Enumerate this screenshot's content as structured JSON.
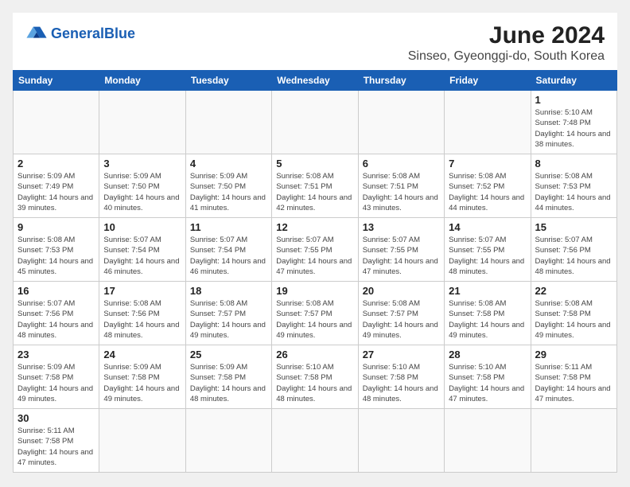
{
  "header": {
    "logo_text_general": "General",
    "logo_text_blue": "Blue",
    "title": "June 2024",
    "subtitle": "Sinseo, Gyeonggi-do, South Korea"
  },
  "weekdays": [
    "Sunday",
    "Monday",
    "Tuesday",
    "Wednesday",
    "Thursday",
    "Friday",
    "Saturday"
  ],
  "weeks": [
    [
      {
        "day": "",
        "info": ""
      },
      {
        "day": "",
        "info": ""
      },
      {
        "day": "",
        "info": ""
      },
      {
        "day": "",
        "info": ""
      },
      {
        "day": "",
        "info": ""
      },
      {
        "day": "",
        "info": ""
      },
      {
        "day": "1",
        "info": "Sunrise: 5:10 AM\nSunset: 7:48 PM\nDaylight: 14 hours and 38 minutes."
      }
    ],
    [
      {
        "day": "2",
        "info": "Sunrise: 5:09 AM\nSunset: 7:49 PM\nDaylight: 14 hours and 39 minutes."
      },
      {
        "day": "3",
        "info": "Sunrise: 5:09 AM\nSunset: 7:50 PM\nDaylight: 14 hours and 40 minutes."
      },
      {
        "day": "4",
        "info": "Sunrise: 5:09 AM\nSunset: 7:50 PM\nDaylight: 14 hours and 41 minutes."
      },
      {
        "day": "5",
        "info": "Sunrise: 5:08 AM\nSunset: 7:51 PM\nDaylight: 14 hours and 42 minutes."
      },
      {
        "day": "6",
        "info": "Sunrise: 5:08 AM\nSunset: 7:51 PM\nDaylight: 14 hours and 43 minutes."
      },
      {
        "day": "7",
        "info": "Sunrise: 5:08 AM\nSunset: 7:52 PM\nDaylight: 14 hours and 44 minutes."
      },
      {
        "day": "8",
        "info": "Sunrise: 5:08 AM\nSunset: 7:53 PM\nDaylight: 14 hours and 44 minutes."
      }
    ],
    [
      {
        "day": "9",
        "info": "Sunrise: 5:08 AM\nSunset: 7:53 PM\nDaylight: 14 hours and 45 minutes."
      },
      {
        "day": "10",
        "info": "Sunrise: 5:07 AM\nSunset: 7:54 PM\nDaylight: 14 hours and 46 minutes."
      },
      {
        "day": "11",
        "info": "Sunrise: 5:07 AM\nSunset: 7:54 PM\nDaylight: 14 hours and 46 minutes."
      },
      {
        "day": "12",
        "info": "Sunrise: 5:07 AM\nSunset: 7:55 PM\nDaylight: 14 hours and 47 minutes."
      },
      {
        "day": "13",
        "info": "Sunrise: 5:07 AM\nSunset: 7:55 PM\nDaylight: 14 hours and 47 minutes."
      },
      {
        "day": "14",
        "info": "Sunrise: 5:07 AM\nSunset: 7:55 PM\nDaylight: 14 hours and 48 minutes."
      },
      {
        "day": "15",
        "info": "Sunrise: 5:07 AM\nSunset: 7:56 PM\nDaylight: 14 hours and 48 minutes."
      }
    ],
    [
      {
        "day": "16",
        "info": "Sunrise: 5:07 AM\nSunset: 7:56 PM\nDaylight: 14 hours and 48 minutes."
      },
      {
        "day": "17",
        "info": "Sunrise: 5:08 AM\nSunset: 7:56 PM\nDaylight: 14 hours and 48 minutes."
      },
      {
        "day": "18",
        "info": "Sunrise: 5:08 AM\nSunset: 7:57 PM\nDaylight: 14 hours and 49 minutes."
      },
      {
        "day": "19",
        "info": "Sunrise: 5:08 AM\nSunset: 7:57 PM\nDaylight: 14 hours and 49 minutes."
      },
      {
        "day": "20",
        "info": "Sunrise: 5:08 AM\nSunset: 7:57 PM\nDaylight: 14 hours and 49 minutes."
      },
      {
        "day": "21",
        "info": "Sunrise: 5:08 AM\nSunset: 7:58 PM\nDaylight: 14 hours and 49 minutes."
      },
      {
        "day": "22",
        "info": "Sunrise: 5:08 AM\nSunset: 7:58 PM\nDaylight: 14 hours and 49 minutes."
      }
    ],
    [
      {
        "day": "23",
        "info": "Sunrise: 5:09 AM\nSunset: 7:58 PM\nDaylight: 14 hours and 49 minutes."
      },
      {
        "day": "24",
        "info": "Sunrise: 5:09 AM\nSunset: 7:58 PM\nDaylight: 14 hours and 49 minutes."
      },
      {
        "day": "25",
        "info": "Sunrise: 5:09 AM\nSunset: 7:58 PM\nDaylight: 14 hours and 48 minutes."
      },
      {
        "day": "26",
        "info": "Sunrise: 5:10 AM\nSunset: 7:58 PM\nDaylight: 14 hours and 48 minutes."
      },
      {
        "day": "27",
        "info": "Sunrise: 5:10 AM\nSunset: 7:58 PM\nDaylight: 14 hours and 48 minutes."
      },
      {
        "day": "28",
        "info": "Sunrise: 5:10 AM\nSunset: 7:58 PM\nDaylight: 14 hours and 47 minutes."
      },
      {
        "day": "29",
        "info": "Sunrise: 5:11 AM\nSunset: 7:58 PM\nDaylight: 14 hours and 47 minutes."
      }
    ],
    [
      {
        "day": "30",
        "info": "Sunrise: 5:11 AM\nSunset: 7:58 PM\nDaylight: 14 hours and 47 minutes."
      },
      {
        "day": "",
        "info": ""
      },
      {
        "day": "",
        "info": ""
      },
      {
        "day": "",
        "info": ""
      },
      {
        "day": "",
        "info": ""
      },
      {
        "day": "",
        "info": ""
      },
      {
        "day": "",
        "info": ""
      }
    ]
  ]
}
